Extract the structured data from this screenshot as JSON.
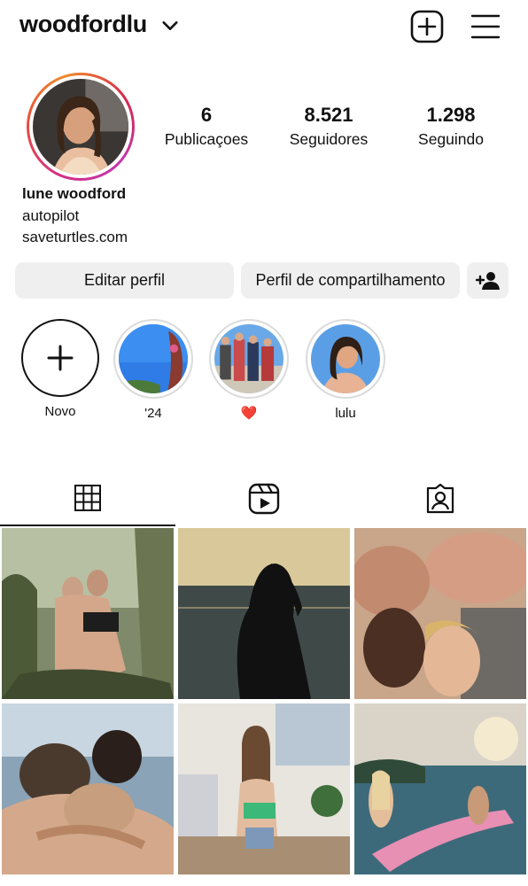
{
  "header": {
    "username": "woodfordlu",
    "icons": [
      "chevron-down-icon",
      "add-post-icon",
      "menu-icon"
    ]
  },
  "profile": {
    "stats": {
      "posts_count": "6",
      "posts_label": "Publicaçoes",
      "followers_count": "8.521",
      "followers_label": "Seguidores",
      "following_count": "1.298",
      "following_label": "Seguindo"
    },
    "bio": {
      "name": "lune woodford",
      "line1": "autopilot",
      "link": "saveturtles.com"
    }
  },
  "actions": {
    "edit_label": "Editar perfil",
    "share_label": "Perfil de compartilhamento",
    "add_user_icon": "add-user-icon"
  },
  "highlights": [
    {
      "label": "Novo",
      "icon": "plus-icon"
    },
    {
      "label": "'24"
    },
    {
      "label": "❤️"
    },
    {
      "label": "lulu"
    }
  ],
  "tabs": [
    {
      "name": "grid",
      "icon": "grid-icon"
    },
    {
      "name": "reels",
      "icon": "reels-icon"
    },
    {
      "name": "tagged",
      "icon": "tagged-icon"
    }
  ],
  "colors": {
    "ring_gradient": [
      "#d32f8a",
      "#e84c3d",
      "#f08a2b"
    ],
    "button_bg": "#efefef",
    "text": "#111111"
  },
  "posts": [
    {
      "id": 1
    },
    {
      "id": 2
    },
    {
      "id": 3
    },
    {
      "id": 4
    },
    {
      "id": 5
    },
    {
      "id": 6
    }
  ]
}
